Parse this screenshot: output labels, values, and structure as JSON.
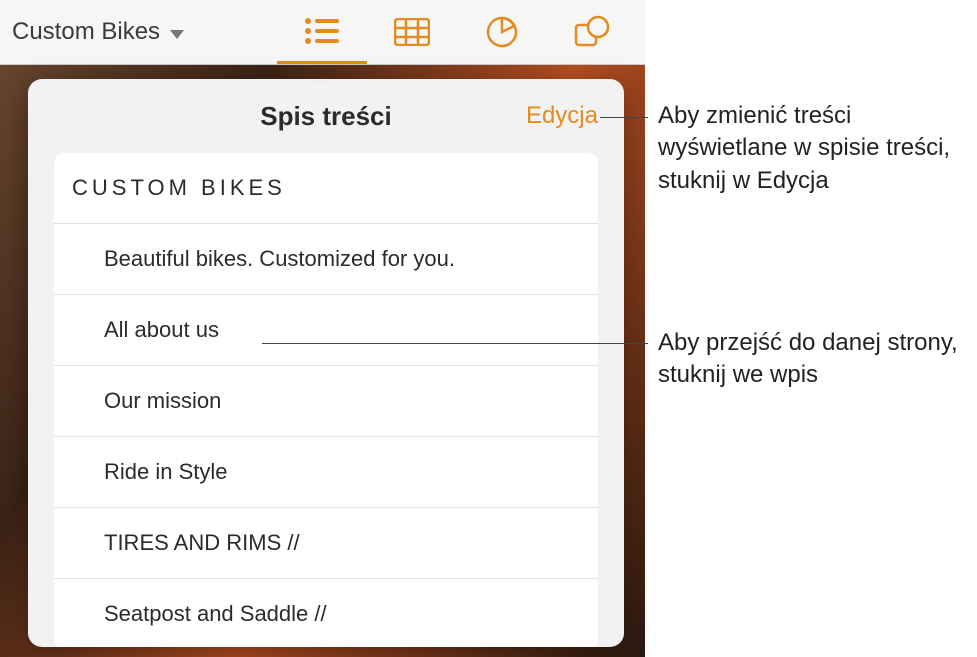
{
  "toolbar": {
    "doc_title": "Custom Bikes"
  },
  "popover": {
    "title": "Spis treści",
    "edit_label": "Edycja"
  },
  "toc": {
    "items": [
      {
        "label": "CUSTOM  BIKES",
        "cls": "head"
      },
      {
        "label": "Beautiful bikes. Customized for you.",
        "cls": "indent"
      },
      {
        "label": "All about us",
        "cls": "indent"
      },
      {
        "label": "Our mission",
        "cls": "indent"
      },
      {
        "label": "Ride in Style",
        "cls": "indent"
      },
      {
        "label": "TIRES AND RIMS //",
        "cls": "indent"
      },
      {
        "label": "Seatpost and Saddle //",
        "cls": "indent"
      }
    ]
  },
  "callouts": {
    "c1": "Aby zmienić treści wyświetlane w spisie treści, stuknij w Edycja",
    "c2": "Aby przejść do danej strony, stuknij we wpis"
  }
}
